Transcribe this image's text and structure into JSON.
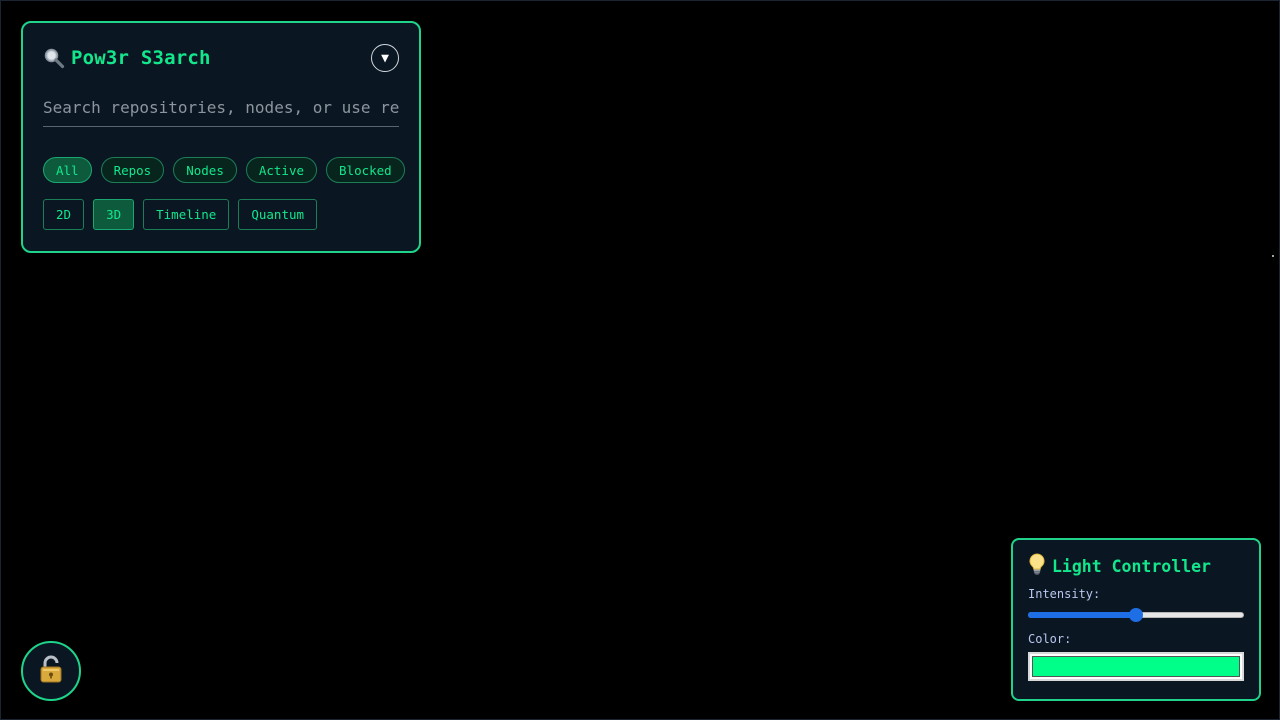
{
  "search": {
    "title": "Pow3r S3arch",
    "icon": "magnifier-icon",
    "collapse_icon": "▼",
    "placeholder": "Search repositories, nodes, or use re",
    "filters": [
      {
        "label": "All",
        "active": true
      },
      {
        "label": "Repos",
        "active": false
      },
      {
        "label": "Nodes",
        "active": false
      },
      {
        "label": "Active",
        "active": false
      },
      {
        "label": "Blocked",
        "active": false
      }
    ],
    "views": [
      {
        "label": "2D",
        "active": false
      },
      {
        "label": "3D",
        "active": true
      },
      {
        "label": "Timeline",
        "active": false
      },
      {
        "label": "Quantum",
        "active": false
      }
    ]
  },
  "lock": {
    "icon": "padlock-open-icon"
  },
  "light": {
    "title": "Light Controller",
    "icon": "lightbulb-icon",
    "intensity_label": "Intensity:",
    "intensity_value": 0.5,
    "color_label": "Color:",
    "color_value": "#00ff88"
  },
  "colors": {
    "accent": "#12e78c",
    "panel_bg": "#0a1622",
    "border": "#1fd48a"
  }
}
